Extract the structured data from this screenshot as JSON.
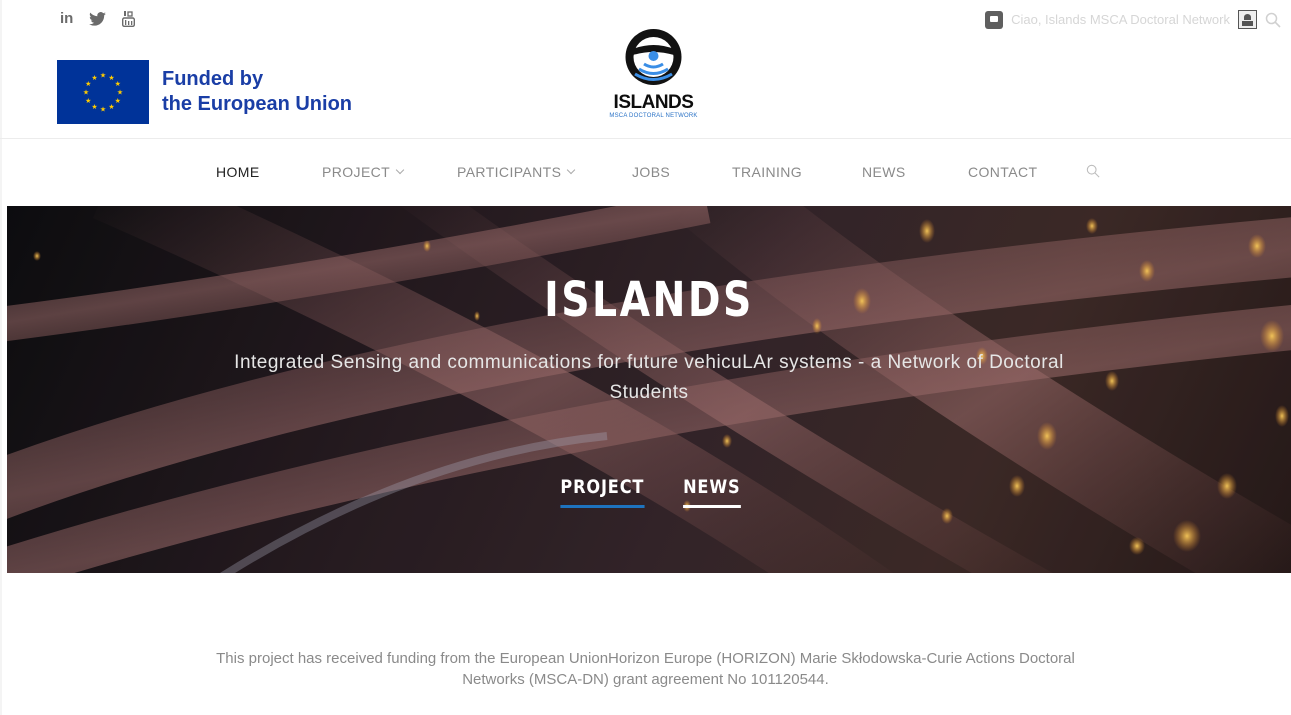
{
  "topbar": {
    "social": [
      {
        "icon": "linkedin-icon",
        "label": "in"
      },
      {
        "icon": "twitter-icon"
      },
      {
        "icon": "youtube-icon"
      }
    ],
    "greeting": "Ciao, Islands MSCA Doctoral Network"
  },
  "eu": {
    "line1": "Funded by",
    "line2": "the European Union",
    "flag_color": "#003399",
    "star_color": "#FFCC00"
  },
  "logo": {
    "name": "ISLANDS",
    "subtitle": "MSCA DOCTORAL NETWORK",
    "accent_color": "#2a72c6"
  },
  "nav": {
    "items": [
      {
        "label": "HOME",
        "active": true
      },
      {
        "label": "PROJECT",
        "dropdown": true
      },
      {
        "label": "PARTICIPANTS",
        "dropdown": true
      },
      {
        "label": "JOBS"
      },
      {
        "label": "TRAINING"
      },
      {
        "label": "NEWS"
      },
      {
        "label": "CONTACT"
      }
    ]
  },
  "hero": {
    "title": "ISLANDS",
    "subtitle": "Integrated Sensing and communications for future vehicuLAr systems - a Network of Doctoral Students",
    "links": [
      {
        "label": "PROJECT",
        "underline_color": "#1e73be"
      },
      {
        "label": "NEWS",
        "underline_color": "#ffffff"
      }
    ]
  },
  "footer": {
    "funding_text": "This project has received funding from the European UnionHorizon Europe (HORIZON) Marie Skłodowska-Curie Actions Doctoral Networks (MSCA-DN) grant agreement No 101120544."
  }
}
